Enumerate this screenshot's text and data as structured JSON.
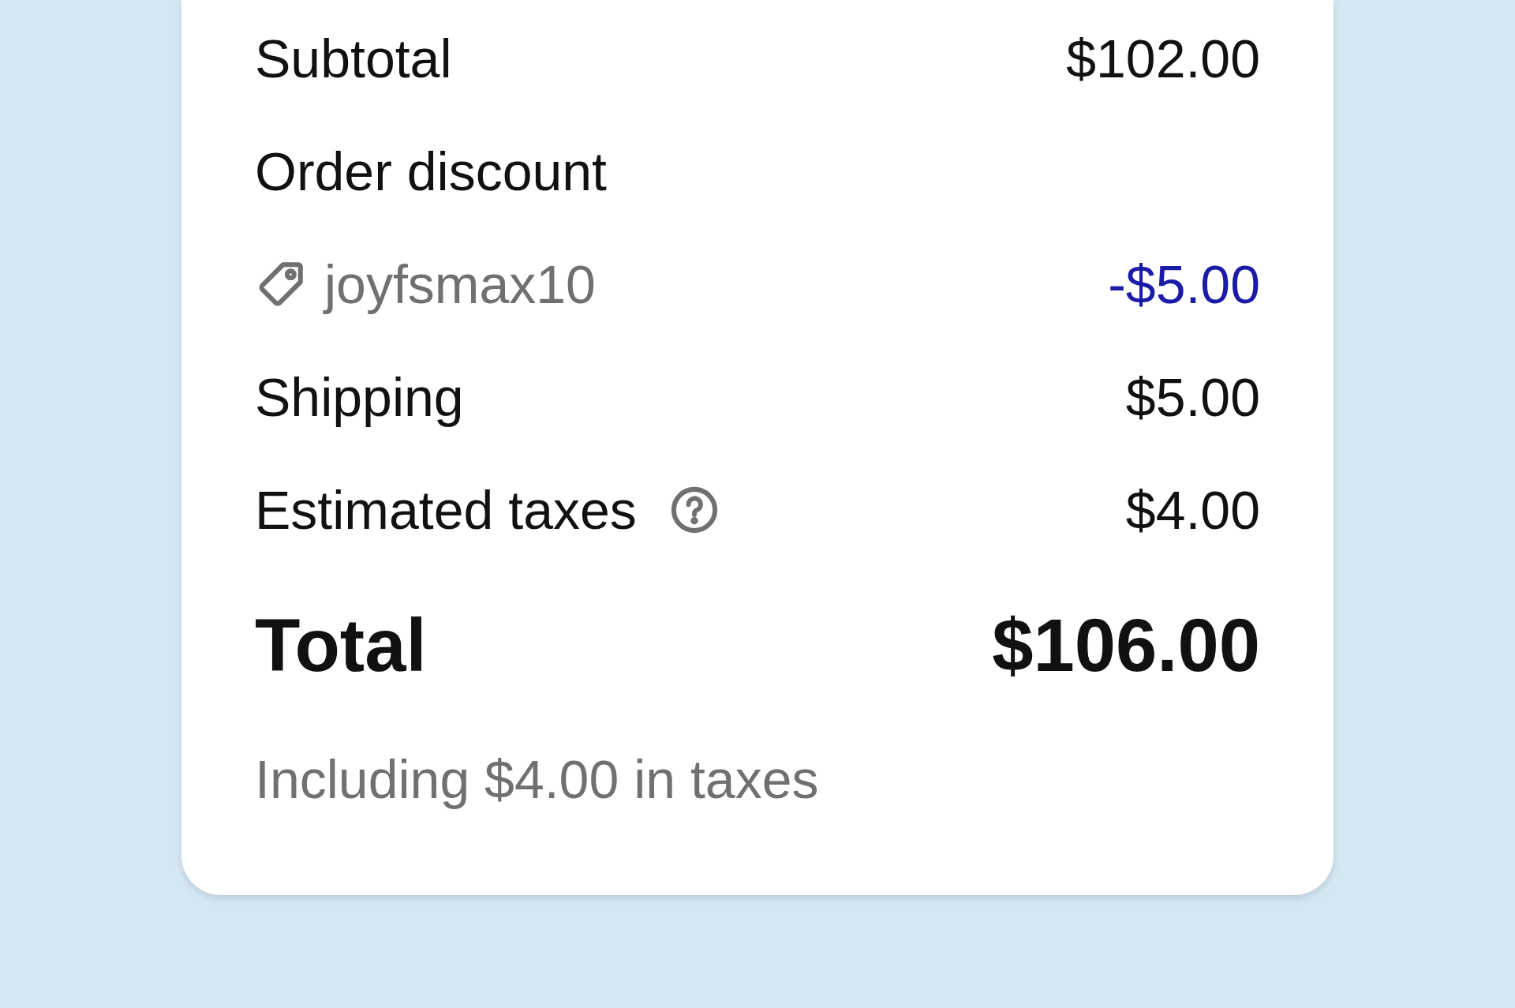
{
  "rows": [
    {
      "kind": "line",
      "label": "Subtotal",
      "value": "$102.00"
    },
    {
      "kind": "heading",
      "label": "Order discount"
    },
    {
      "kind": "discount",
      "code": "joyfsmax10",
      "value": "-$5.00"
    },
    {
      "kind": "line",
      "label": "Shipping",
      "value": "$5.00"
    },
    {
      "kind": "info",
      "label": "Estimated taxes",
      "value": "$4.00"
    }
  ],
  "total": {
    "label": "Total",
    "value": "$106.00"
  },
  "note": "Including $4.00 in taxes"
}
